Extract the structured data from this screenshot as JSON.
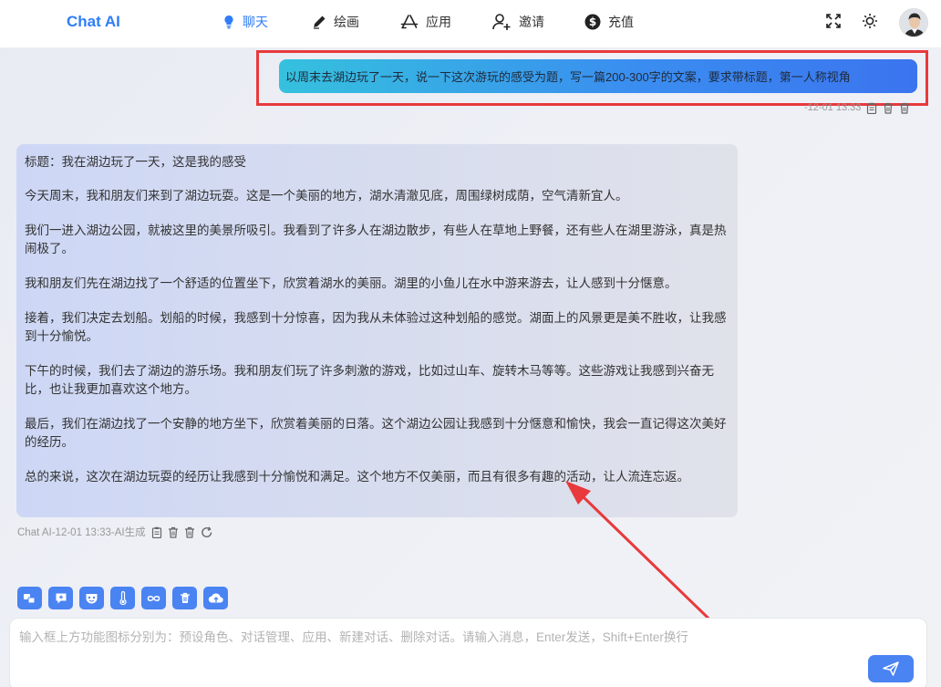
{
  "header": {
    "brand": "Chat AI",
    "nav": [
      {
        "label": "聊天",
        "icon": "lightbulb-icon",
        "active": true
      },
      {
        "label": "绘画",
        "icon": "pen-icon",
        "active": false
      },
      {
        "label": "应用",
        "icon": "app-store-icon",
        "active": false
      },
      {
        "label": "邀请",
        "icon": "add-user-icon",
        "active": false
      },
      {
        "label": "充值",
        "icon": "dollar-icon",
        "active": false
      }
    ],
    "right_icons": [
      "fullscreen-icon",
      "theme-sun-icon",
      "user-avatar"
    ]
  },
  "conversation": {
    "user_message": "以周末去湖边玩了一天，说一下这次游玩的感受为题，写一篇200-300字的文案，要求带标题，第一人称视角",
    "user_meta": "-12-01 13:33",
    "ai_paragraphs": [
      "标题：我在湖边玩了一天，这是我的感受",
      "今天周末，我和朋友们来到了湖边玩耍。这是一个美丽的地方，湖水清澈见底，周围绿树成荫，空气清新宜人。",
      "我们一进入湖边公园，就被这里的美景所吸引。我看到了许多人在湖边散步，有些人在草地上野餐，还有些人在湖里游泳，真是热闹极了。",
      "我和朋友们先在湖边找了一个舒适的位置坐下，欣赏着湖水的美丽。湖里的小鱼儿在水中游来游去，让人感到十分惬意。",
      "接着，我们决定去划船。划船的时候，我感到十分惊喜，因为我从未体验过这种划船的感觉。湖面上的风景更是美不胜收，让我感到十分愉悦。",
      "下午的时候，我们去了湖边的游乐场。我和朋友们玩了许多刺激的游戏，比如过山车、旋转木马等等。这些游戏让我感到兴奋无比，也让我更加喜欢这个地方。",
      "最后，我们在湖边找了一个安静的地方坐下，欣赏着美丽的日落。这个湖边公园让我感到十分惬意和愉快，我会一直记得这次美好的经历。",
      "总的来说，这次在湖边玩耍的经历让我感到十分愉悦和满足。这个地方不仅美丽，而且有很多有趣的活动，让人流连忘返。"
    ],
    "ai_meta": "Chat AI-12-01 13:33-AI生成"
  },
  "toolbar": {
    "buttons": [
      "preset-role-icon",
      "chat-manage-icon",
      "app-mask-icon",
      "temperature-icon",
      "infinite-icon",
      "delete-icon",
      "cloud-upload-icon"
    ]
  },
  "input": {
    "placeholder": "输入框上方功能图标分别为：预设角色、对话管理、应用、新建对话、删除对话。请输入消息，Enter发送，Shift+Enter换行",
    "value": ""
  },
  "colors": {
    "accent": "#2f7df6",
    "button": "#4a83f2",
    "highlight": "#e8393c"
  }
}
